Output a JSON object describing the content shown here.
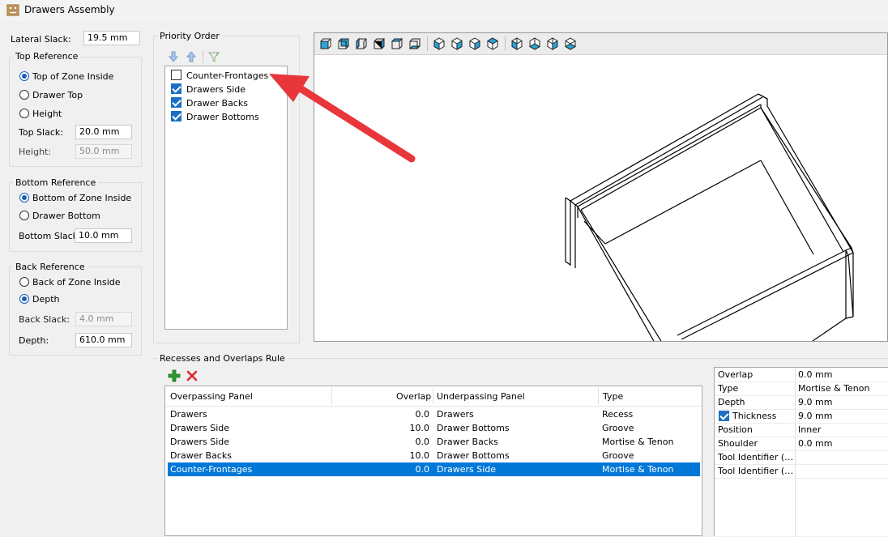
{
  "window": {
    "title": "Drawers Assembly"
  },
  "lateral_slack": {
    "label": "Lateral Slack:",
    "value": "19.5 mm"
  },
  "top_reference": {
    "title": "Top Reference",
    "options": [
      "Top of Zone Inside",
      "Drawer Top",
      "Height"
    ],
    "selected": "Top of Zone Inside",
    "top_slack_label": "Top Slack:",
    "top_slack_value": "20.0 mm",
    "height_label": "Height:",
    "height_value": "50.0 mm"
  },
  "bottom_reference": {
    "title": "Bottom Reference",
    "options": [
      "Bottom of Zone Inside",
      "Drawer Bottom"
    ],
    "selected": "Bottom of Zone Inside",
    "slack_label": "Bottom Slack:",
    "slack_value": "10.0 mm"
  },
  "back_reference": {
    "title": "Back Reference",
    "options": [
      "Back of Zone Inside",
      "Depth"
    ],
    "selected": "Depth",
    "slack_label": "Back Slack:",
    "slack_value": "4.0 mm",
    "depth_label": "Depth:",
    "depth_value": "610.0 mm"
  },
  "priority_order": {
    "title": "Priority Order",
    "toolbar_icons": [
      "arrow-down-icon",
      "arrow-up-icon",
      "filter-icon"
    ],
    "items": [
      {
        "label": "Counter-Frontages",
        "checked": false
      },
      {
        "label": "Drawers Side",
        "checked": true
      },
      {
        "label": "Drawer Backs",
        "checked": true
      },
      {
        "label": "Drawer Bottoms",
        "checked": true
      }
    ]
  },
  "viewport": {
    "toolbar_icons": [
      "view-front-icon",
      "view-back-icon",
      "view-left-icon",
      "view-right-icon",
      "view-top-icon",
      "view-bottom-icon",
      "iso-view-1-icon",
      "iso-view-2-icon",
      "iso-view-3-icon",
      "iso-view-4-icon",
      "iso-view-5-icon",
      "iso-view-6-icon",
      "iso-view-7-icon",
      "iso-view-8-icon"
    ]
  },
  "annotation": {
    "arrow_color": "#e8363b"
  },
  "recesses": {
    "title": "Recesses and Overlaps Rule",
    "toolbar_icons": [
      "add-icon",
      "delete-icon"
    ],
    "columns": [
      "Overpassing Panel",
      "Overlap",
      "Underpassing Panel",
      "Type"
    ],
    "rows": [
      {
        "over": "Drawers",
        "overlap": "0.0",
        "under": "Drawers",
        "type": "Recess"
      },
      {
        "over": "Drawers Side",
        "overlap": "10.0",
        "under": "Drawer Bottoms",
        "type": "Groove"
      },
      {
        "over": "Drawers Side",
        "overlap": "0.0",
        "under": "Drawer Backs",
        "type": "Mortise & Tenon"
      },
      {
        "over": "Drawer Backs",
        "overlap": "10.0",
        "under": "Drawer Bottoms",
        "type": "Groove"
      },
      {
        "over": "Counter-Frontages",
        "overlap": "0.0",
        "under": "Drawers Side",
        "type": "Mortise & Tenon",
        "selected": true
      }
    ]
  },
  "properties": {
    "rows": [
      {
        "name": "Overlap",
        "value": "0.0 mm"
      },
      {
        "name": "Type",
        "value": "Mortise & Tenon"
      },
      {
        "name": "Depth",
        "value": "9.0 mm"
      },
      {
        "name": "Thickness",
        "value": "9.0 mm",
        "checked": true
      },
      {
        "name": "Position",
        "value": "Inner"
      },
      {
        "name": "Shoulder",
        "value": "0.0 mm"
      },
      {
        "name": "Tool Identifier (…",
        "value": ""
      },
      {
        "name": "Tool Identifier (…",
        "value": ""
      }
    ]
  },
  "colors": {
    "accent": "#0078d7",
    "add": "#2e9a2e",
    "delete": "#d9262c"
  }
}
